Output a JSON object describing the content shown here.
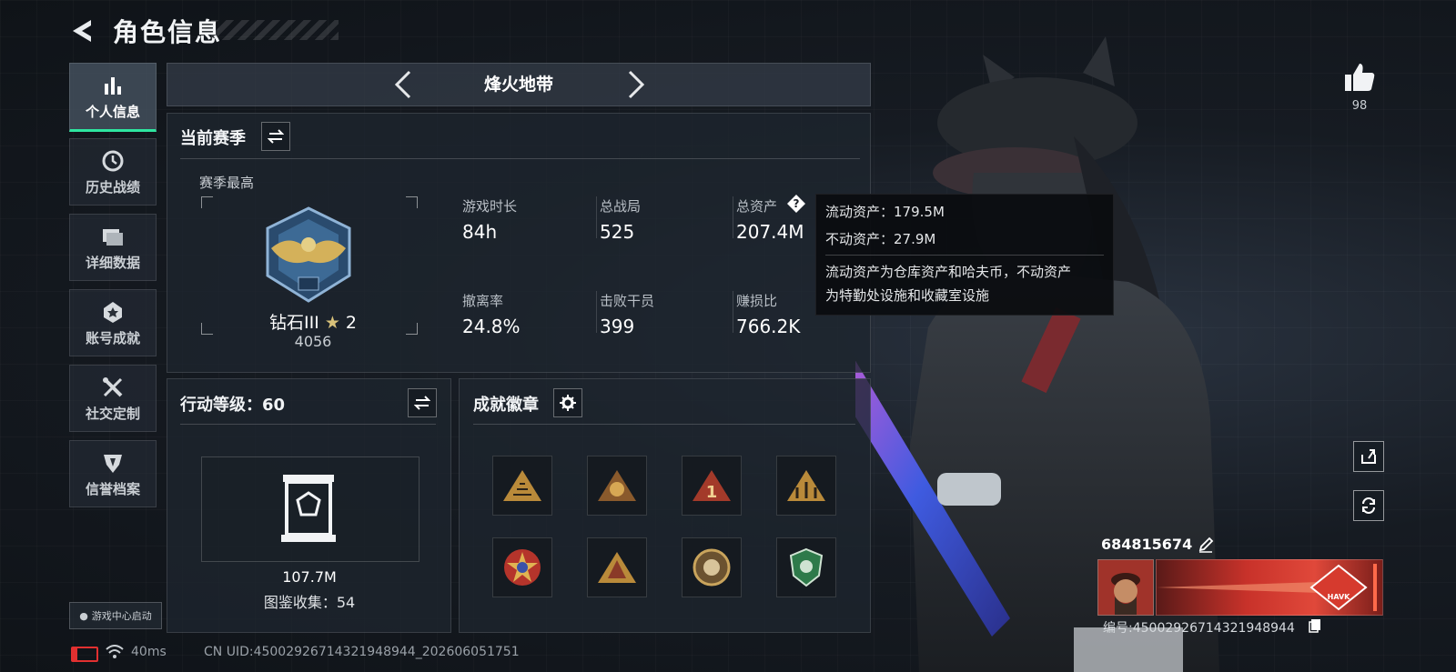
{
  "header": {
    "title": "角色信息"
  },
  "sidebar": {
    "items": [
      {
        "label": "个人信息",
        "icon": "bar-chart-icon",
        "active": true
      },
      {
        "label": "历史战绩",
        "icon": "clock-icon"
      },
      {
        "label": "详细数据",
        "icon": "folder-icon"
      },
      {
        "label": "账号成就",
        "icon": "medal-icon"
      },
      {
        "label": "社交定制",
        "icon": "tools-icon"
      },
      {
        "label": "信誉档案",
        "icon": "shield-icon"
      }
    ],
    "launch_label": "游戏中心启动"
  },
  "mode": {
    "name": "烽火地带"
  },
  "season": {
    "title": "当前赛季",
    "best_label": "赛季最高",
    "rank_name": "钻石III",
    "rank_stars": "2",
    "rank_points": "4056",
    "stats": [
      {
        "label": "游戏时长",
        "value": "84h"
      },
      {
        "label": "总战局",
        "value": "525"
      },
      {
        "label": "总资产",
        "value": "207.4M"
      },
      {
        "label": "撤离率",
        "value": "24.8%"
      },
      {
        "label": "击败干员",
        "value": "399"
      },
      {
        "label": "赚损比",
        "value": "766.2K"
      }
    ]
  },
  "tooltip": {
    "line1": "流动资产：179.5M",
    "line2": "不动资产：27.9M",
    "desc1": "流动资产为仓库资产和哈夫币，不动资产",
    "desc2": "为特勤处设施和收藏室设施"
  },
  "action_level": {
    "title": "行动等级：60",
    "value": "107.7M",
    "collection": "图鉴收集：54"
  },
  "badges": {
    "title": "成就徽章",
    "items": [
      "badge-1",
      "badge-2",
      "badge-3",
      "badge-4",
      "badge-5",
      "badge-6",
      "badge-7",
      "badge-8"
    ]
  },
  "profile": {
    "likes": "98",
    "player_id": "684815674",
    "serial": "编号:45002926714321948944",
    "banner_text": "HAVK"
  },
  "status": {
    "ping": "40ms",
    "uid": "CN UID:45002926714321948944_202606051751"
  },
  "colors": {
    "accent": "#2ee6a0",
    "badge_gold": "#b98a3a",
    "battery_red": "#e23030"
  }
}
